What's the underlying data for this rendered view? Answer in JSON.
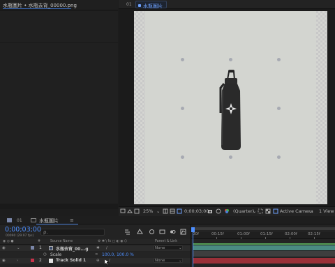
{
  "project": {
    "title": "水瓶圖片 • 水瓶去背_00000.png"
  },
  "viewer": {
    "tab_index": "01",
    "tab_label": "水瓶圖片",
    "toolbar": {
      "zoom": "25%",
      "timecode": "0;00;03;00",
      "resolution": "(Quarter)",
      "camera": "Active Camera",
      "views": "1 View"
    }
  },
  "timeline": {
    "tab_index": "01",
    "tab_label": "水瓶圖片",
    "tab_close": "≡",
    "timecode": "0;00;03;00",
    "frame_readout": "00090 (29.97 fps)",
    "search_placeholder": "ρ.",
    "headers": {
      "source_name": "Source Name",
      "parent_link": "Parent & Link"
    },
    "layers": [
      {
        "index": "1",
        "name": "水瓶去背_00...g",
        "parent": "None",
        "color": "#7a86a8"
      },
      {
        "property": "Scale",
        "value": "100.0, 100.0 %"
      },
      {
        "index": "2",
        "name": "Track Solid 1",
        "parent": "None",
        "color": "#c8324a"
      }
    ],
    "ruler": [
      "00f",
      "00:15f",
      "01:00f",
      "01:15f",
      "02:00f",
      "02:15f"
    ]
  }
}
